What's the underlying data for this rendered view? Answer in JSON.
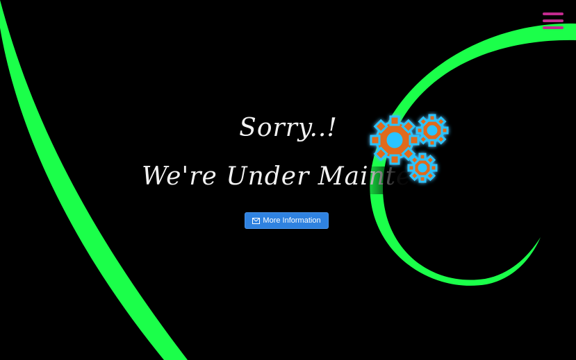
{
  "page": {
    "heading_line1": "Sorry..!",
    "heading_line2": "We're Under Maintenance",
    "button_label": "More Information",
    "button_icon": "envelope-icon"
  },
  "menu": {
    "icon": "hamburger-menu-icon"
  },
  "colors": {
    "background": "#000000",
    "swirl": "#1bff4a",
    "gear_fill": "#e06a1a",
    "gear_glow": "#2bc4ff",
    "menu_icon": "#c22a8e",
    "button": "#2f82e0",
    "text": "#f2f2f2"
  }
}
